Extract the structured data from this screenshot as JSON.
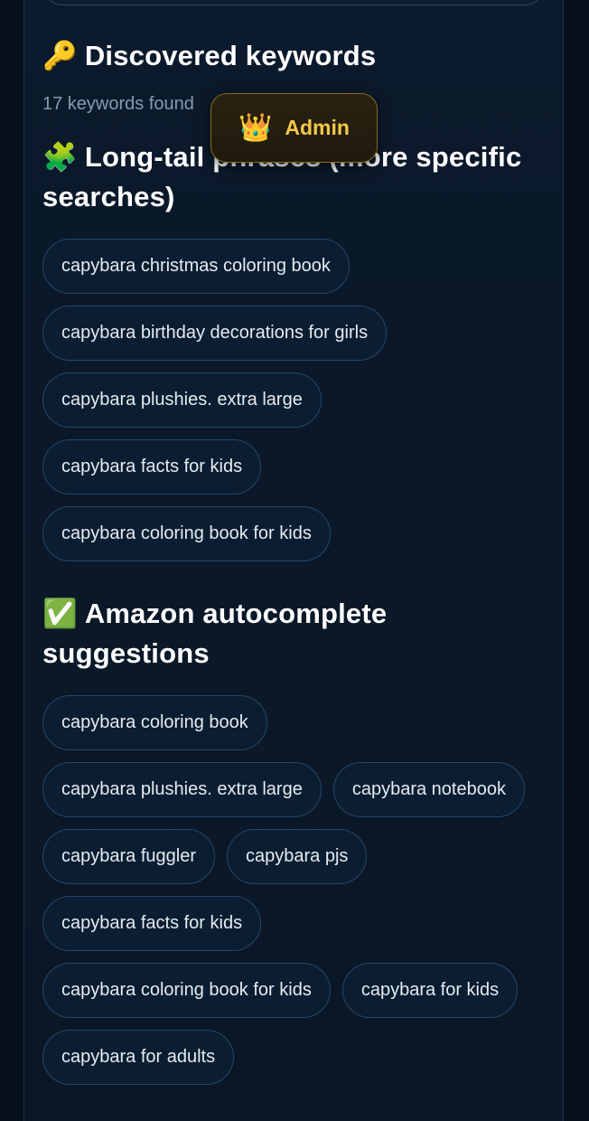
{
  "keywords": {
    "title": "Discovered keywords",
    "title_icon": "key-icon",
    "count_text": "17 keywords found"
  },
  "long_tail": {
    "title": "Long-tail phrases (more specific searches)",
    "title_icon": "puzzle-icon",
    "items": [
      "capybara christmas coloring book",
      "capybara birthday decorations for girls",
      "capybara plushies. extra large",
      "capybara facts for kids",
      "capybara coloring book for kids"
    ]
  },
  "autocomplete": {
    "title": "Amazon autocomplete suggestions",
    "title_icon": "check-mark-icon",
    "items": [
      "capybara coloring book",
      "capybara plushies. extra large",
      "capybara notebook",
      "capybara fuggler",
      "capybara pjs",
      "capybara facts for kids",
      "capybara coloring book for kids",
      "capybara for kids",
      "capybara for adults"
    ]
  },
  "admin_badge": {
    "label": "Admin",
    "icon": "crown-icon",
    "accent": "#f5c84a"
  },
  "colors": {
    "background": "#06101b",
    "panel": "#0b1a2c",
    "chip_border": "#27466a"
  }
}
